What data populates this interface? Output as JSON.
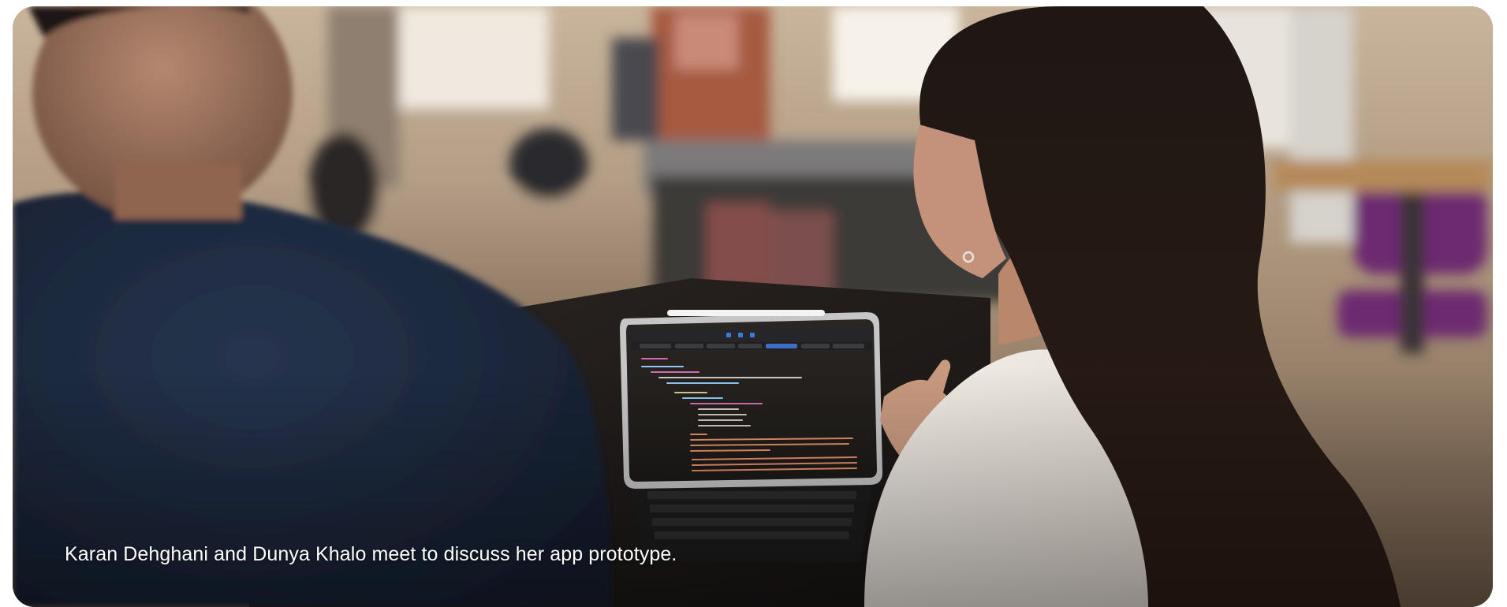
{
  "figure": {
    "caption": "Karan Dehghani and Dunya Khalo meet to discuss her app prototype."
  }
}
